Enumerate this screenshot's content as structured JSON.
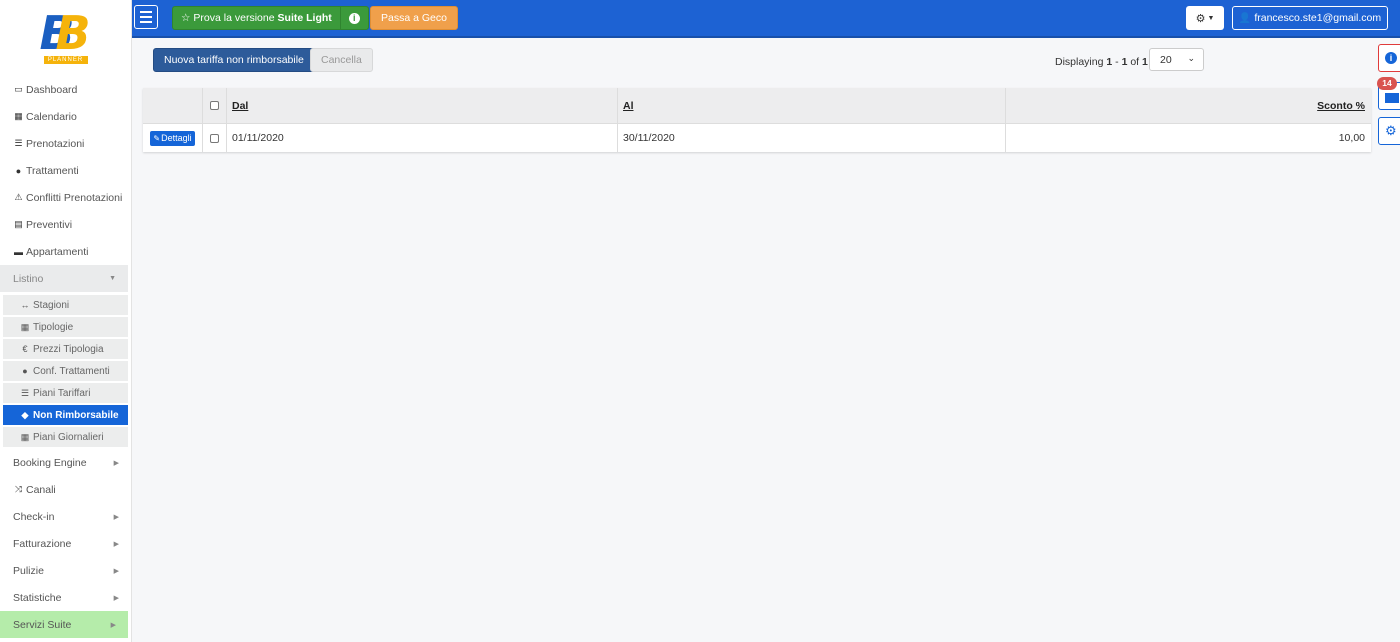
{
  "brand": {
    "logo_tag": "PLANNER"
  },
  "sidebar": {
    "items": [
      {
        "label": "Dashboard",
        "icon": "monitor-icon"
      },
      {
        "label": "Calendario",
        "icon": "calendar-icon"
      },
      {
        "label": "Prenotazioni",
        "icon": "list-icon"
      },
      {
        "label": "Trattamenti",
        "icon": "apple-icon"
      },
      {
        "label": "Conflitti Prenotazioni",
        "icon": "warning-icon"
      },
      {
        "label": "Preventivi",
        "icon": "calculator-icon"
      },
      {
        "label": "Appartamenti",
        "icon": "bed-icon"
      }
    ],
    "listino": {
      "label": "Listino",
      "sub": [
        {
          "label": "Stagioni",
          "icon": "arrows-h-icon"
        },
        {
          "label": "Tipologie",
          "icon": "grid-icon"
        },
        {
          "label": "Prezzi Tipologia",
          "icon": "euro-icon"
        },
        {
          "label": "Conf. Trattamenti",
          "icon": "apple-icon"
        },
        {
          "label": "Piani Tariffari",
          "icon": "list-icon"
        },
        {
          "label": "Non Rimborsabile",
          "icon": "tag-icon"
        },
        {
          "label": "Piani Giornalieri",
          "icon": "grid-icon"
        }
      ]
    },
    "bottom": [
      {
        "label": "Booking Engine"
      },
      {
        "label": "Canali"
      },
      {
        "label": "Check-in"
      },
      {
        "label": "Fatturazione"
      },
      {
        "label": "Pulizie"
      },
      {
        "label": "Statistiche"
      },
      {
        "label": "Servizi Suite"
      }
    ]
  },
  "topbar": {
    "suite_prefix": "Prova la versione",
    "suite_bold": "Suite Light",
    "geco_label": "Passa a Geco",
    "user_email": "francesco.ste1@gmail.com"
  },
  "toolbar": {
    "new_label": "Nuova tariffa non rimborsabile",
    "cancel_label": "Cancella",
    "displaying_prefix": "Displaying",
    "displaying_from": "1",
    "displaying_to": "1",
    "displaying_of": "of",
    "displaying_total": "1",
    "page_size": "20"
  },
  "table": {
    "columns": {
      "dal": "Dal",
      "al": "Al",
      "sconto": "Sconto %"
    },
    "rows": [
      {
        "action": "Dettagli",
        "dal": "01/11/2020",
        "al": "30/11/2020",
        "sconto": "10,00"
      }
    ]
  },
  "floating": {
    "mail_badge": "14"
  },
  "colors": {
    "primary": "#1d62d3",
    "active": "#1565d8",
    "success": "#3b9a3b",
    "warning": "#f0a04b",
    "dark_button": "#2d5b9a"
  }
}
